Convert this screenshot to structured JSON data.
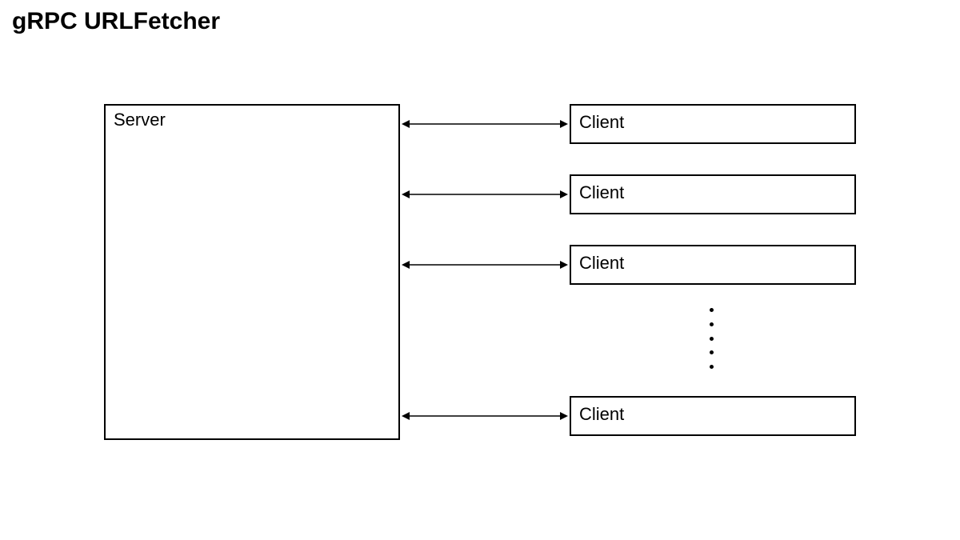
{
  "title": "gRPC URLFetcher",
  "server": {
    "label": "Server"
  },
  "clients": [
    {
      "label": "Client"
    },
    {
      "label": "Client"
    },
    {
      "label": "Client"
    },
    {
      "label": "Client"
    }
  ],
  "ellipsis_dot_count": 5
}
